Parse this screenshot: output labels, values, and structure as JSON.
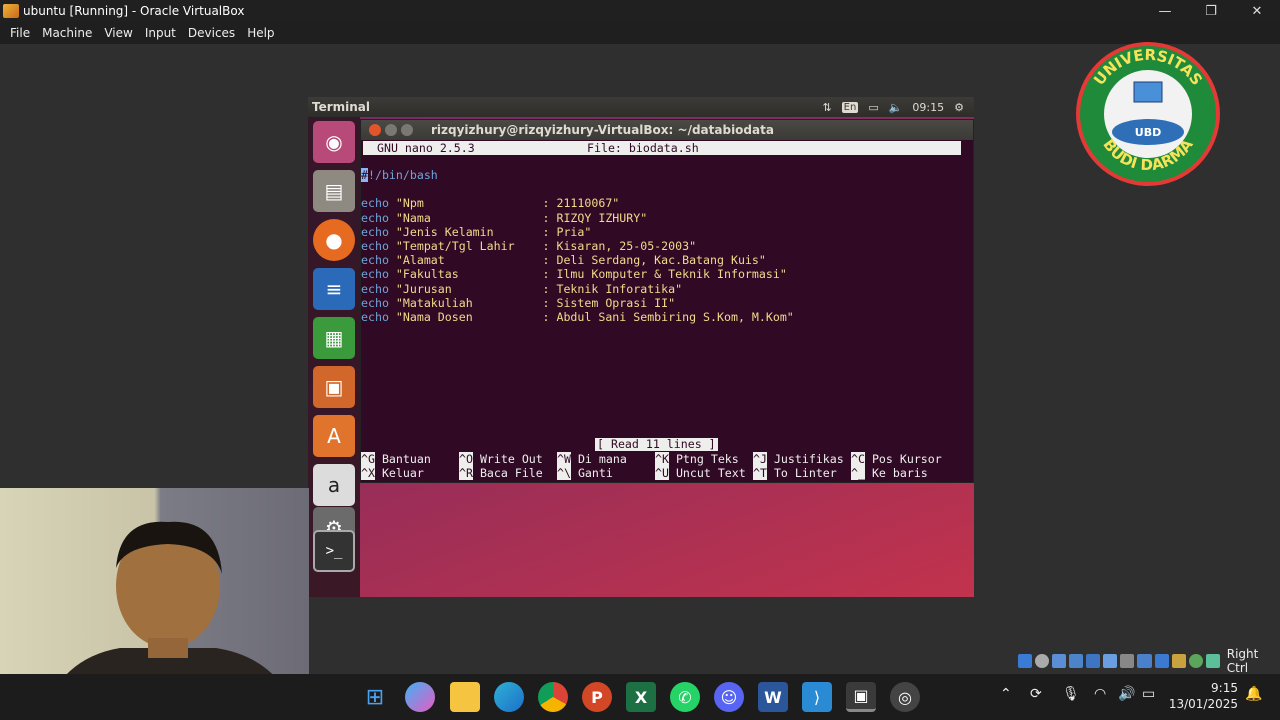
{
  "host": {
    "title": "ubuntu [Running] - Oracle VirtualBox",
    "menu": [
      "File",
      "Machine",
      "View",
      "Input",
      "Devices",
      "Help"
    ],
    "controls": [
      "—",
      "❐",
      "✕"
    ]
  },
  "guest": {
    "topbar_title": "Terminal",
    "lang": "En",
    "time": "09:15",
    "launcher": [
      "ubuntu-dash-icon",
      "files-icon",
      "firefox-icon",
      "writer-icon",
      "calc-icon",
      "impress-icon",
      "software-center-icon",
      "amazon-icon",
      "system-settings-icon",
      "terminal-icon"
    ]
  },
  "terminal": {
    "title": "rizqyizhury@rizqyizhury-VirtualBox: ~/databiodata",
    "nano_version": "GNU nano 2.5.3",
    "nano_file": "File: biodata.sh",
    "shebang_cursor": "#",
    "shebang_rest": "!/bin/bash",
    "lines": [
      {
        "kw": "echo",
        "key": "\"Npm                 ",
        "val": ": 21110067\""
      },
      {
        "kw": "echo",
        "key": "\"Nama                ",
        "val": ": RIZQY IZHURY\""
      },
      {
        "kw": "echo",
        "key": "\"Jenis Kelamin       ",
        "val": ": Pria\""
      },
      {
        "kw": "echo",
        "key": "\"Tempat/Tgl Lahir    ",
        "val": ": Kisaran, 25-05-2003\""
      },
      {
        "kw": "echo",
        "key": "\"Alamat              ",
        "val": ": Deli Serdang, Kac.Batang Kuis\""
      },
      {
        "kw": "echo",
        "key": "\"Fakultas            ",
        "val": ": Ilmu Komputer & Teknik Informasi\""
      },
      {
        "kw": "echo",
        "key": "\"Jurusan             ",
        "val": ": Teknik Inforatika\""
      },
      {
        "kw": "echo",
        "key": "\"Matakuliah          ",
        "val": ": Sistem Oprasi II\""
      },
      {
        "kw": "echo",
        "key": "\"Nama Dosen          ",
        "val": ": Abdul Sani Sembiring S.Kom, M.Kom\""
      }
    ],
    "status": "[ Read 11 lines ]",
    "shortcuts_row1": [
      {
        "k": "^G",
        "l": " Bantuan"
      },
      {
        "k": "^O",
        "l": " Write Out"
      },
      {
        "k": "^W",
        "l": " Di mana"
      },
      {
        "k": "^K",
        "l": " Ptng Teks"
      },
      {
        "k": "^J",
        "l": " Justifikas"
      },
      {
        "k": "^C",
        "l": " Pos Kursor"
      }
    ],
    "shortcuts_row2": [
      {
        "k": "^X",
        "l": " Keluar"
      },
      {
        "k": "^R",
        "l": " Baca File"
      },
      {
        "k": "^\\",
        "l": " Ganti"
      },
      {
        "k": "^U",
        "l": " Uncut Text"
      },
      {
        "k": "^T",
        "l": " To Linter"
      },
      {
        "k": "^_",
        "l": " Ke baris"
      }
    ]
  },
  "logo": {
    "top": "UNIVERSITAS",
    "bottom": "BUDI DARMA",
    "center": "UBD"
  },
  "vm_tray": {
    "right_ctrl": "Right Ctrl"
  },
  "taskbar": {
    "time": "9:15",
    "date": "13/01/2025",
    "apps": [
      "windows-start-icon",
      "copilot-icon",
      "file-explorer-icon",
      "edge-icon",
      "chrome-icon",
      "powerpoint-icon",
      "excel-icon",
      "whatsapp-icon",
      "discord-icon",
      "word-icon",
      "vscode-icon",
      "virtualbox-icon",
      "obs-icon"
    ]
  },
  "colors": {
    "terminal_bg": "#300a24",
    "keyword": "#6fa3d8",
    "string": "#f2d98b",
    "nano_bar": "#eeeeec",
    "logo_green": "#1f8a3a"
  }
}
